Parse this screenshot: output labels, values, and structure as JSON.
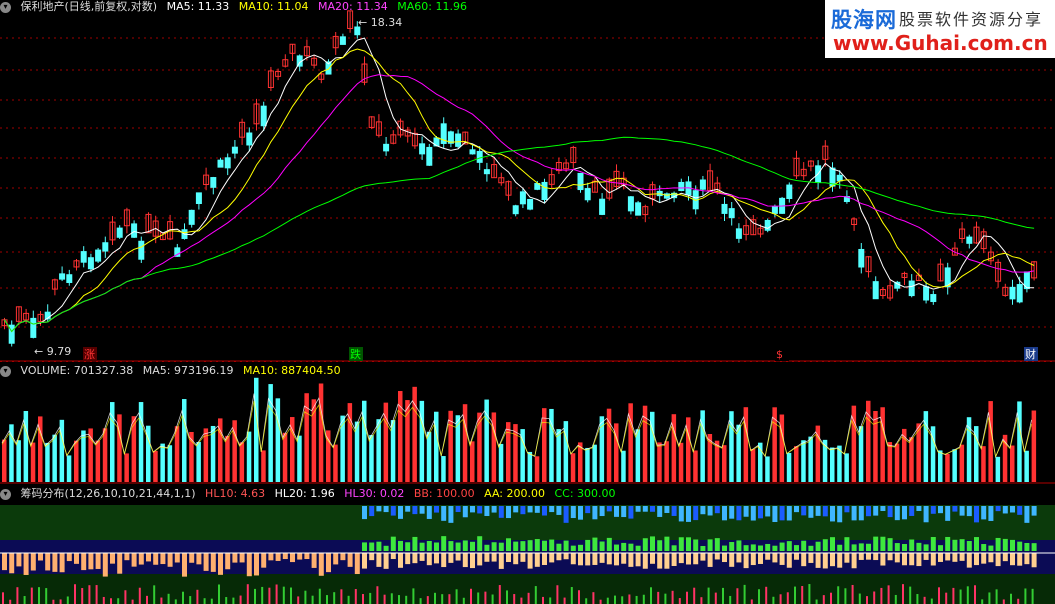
{
  "main": {
    "title": "保利地产(日线,前复权,对数)",
    "ma5": "MA5: 11.33",
    "ma10": "MA10: 11.04",
    "ma20": "MA20: 11.34",
    "ma60": "MA60: 11.96",
    "high_label": "18.34",
    "low_label": "9.79",
    "markers": [
      "涨",
      "跌",
      "$",
      "财"
    ]
  },
  "volume": {
    "title": "VOLUME: 701327.38",
    "ma5": "MA5: 973196.19",
    "ma10": "MA10: 887404.50"
  },
  "chips": {
    "title": "筹码分布(12,26,10,10,21,44,1,1)",
    "hl10": "HL10: 4.63",
    "hl20": "HL20: 1.96",
    "hl30": "HL30: 0.02",
    "bb": "BB: 100.00",
    "aa": "AA: 200.00",
    "cc": "CC: 300.00"
  },
  "logo": {
    "brand": "股海网",
    "slogan": "股票软件资源分享",
    "url": "www.Guhai.com.cn"
  },
  "colors": {
    "up": "#ff3232",
    "down": "#54ffff",
    "ma5": "#ffffff",
    "ma10": "#ffff00",
    "ma20": "#ff00ff",
    "ma60": "#00ff00",
    "grid": "#a00000"
  }
}
